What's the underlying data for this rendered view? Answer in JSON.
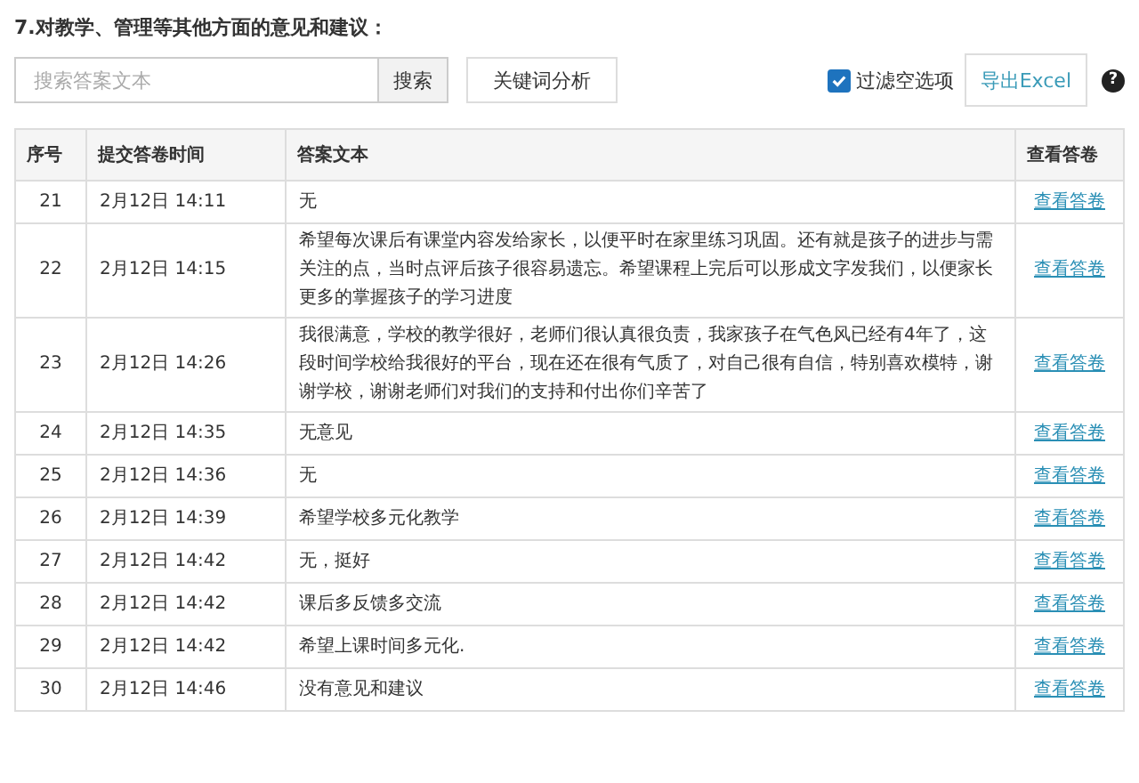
{
  "question": {
    "title": "7.对教学、管理等其他方面的意见和建议："
  },
  "toolbar": {
    "search": {
      "placeholder": "搜索答案文本",
      "button": "搜索"
    },
    "keyword_button": "关键词分析",
    "filter": {
      "label": "过滤空选项",
      "checked": true
    },
    "export_button": "导出Excel",
    "help": "?"
  },
  "table": {
    "columns": [
      "序号",
      "提交答卷时间",
      "答案文本",
      "查看答卷"
    ],
    "rows": [
      {
        "index": "21",
        "time": "2月12日 14:11",
        "answer": "无",
        "link": "查看答卷"
      },
      {
        "index": "22",
        "time": "2月12日 14:15",
        "answer": "希望每次课后有课堂内容发给家长，以便平时在家里练习巩固。还有就是孩子的进步与需关注的点，当时点评后孩子很容易遗忘。希望课程上完后可以形成文字发我们，以便家长更多的掌握孩子的学习进度",
        "link": "查看答卷"
      },
      {
        "index": "23",
        "time": "2月12日 14:26",
        "answer": "我很满意，学校的教学很好，老师们很认真很负责，我家孩子在气色风已经有4年了，这段时间学校给我很好的平台，现在还在很有气质了，对自己很有自信，特别喜欢模特，谢谢学校，谢谢老师们对我们的支持和付出你们辛苦了",
        "link": "查看答卷"
      },
      {
        "index": "24",
        "time": "2月12日 14:35",
        "answer": "无意见",
        "link": "查看答卷"
      },
      {
        "index": "25",
        "time": "2月12日 14:36",
        "answer": "无",
        "link": "查看答卷"
      },
      {
        "index": "26",
        "time": "2月12日 14:39",
        "answer": "希望学校多元化教学",
        "link": "查看答卷"
      },
      {
        "index": "27",
        "time": "2月12日 14:42",
        "answer": "无，挺好",
        "link": "查看答卷"
      },
      {
        "index": "28",
        "time": "2月12日 14:42",
        "answer": "课后多反馈多交流",
        "link": "查看答卷"
      },
      {
        "index": "29",
        "time": "2月12日 14:42",
        "answer": "希望上课时间多元化.",
        "link": "查看答卷"
      },
      {
        "index": "30",
        "time": "2月12日 14:46",
        "answer": "没有意见和建议",
        "link": "查看答卷"
      }
    ]
  }
}
